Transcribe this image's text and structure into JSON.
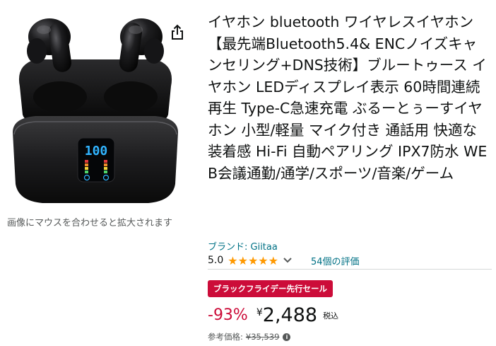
{
  "product": {
    "image_alt": "ワイヤレスイヤホン 充電ケース LEDディスプレイ",
    "case_display": "100",
    "zoom_hint": "画像にマウスを合わせると拡大されます",
    "title": "イヤホン bluetooth ワイヤレスイヤホン 【最先端Bluetooth5.4& ENCノイズキャンセリング+DNS技術】ブルートゥース イヤホン LEDディスプレイ表示 60時間連続再生 Type-C急速充電 ぶるーとぅーすイヤホン 小型/軽量 マイク付き 通話用 快適な装着感 Hi-Fi 自動ペアリング IPX7防水 WEB会議通勤/通学/スポーツ/音楽/ゲーム",
    "brand": "ブランド: Giitaa",
    "rating": "5.0",
    "rating_value": 5,
    "stars": "★★★★★",
    "reviews": "54個の評価",
    "deal_badge": "ブラックフライデー先行セール",
    "discount": "-93%",
    "currency": "¥",
    "price": "2,488",
    "tax_label": "税込",
    "list_price_label": "参考価格:",
    "list_price": "¥35,539",
    "info_icon_glyph": "i"
  },
  "icons": {
    "share": "share-icon",
    "chevron": "chevron-down-icon",
    "info": "info-icon"
  },
  "colors": {
    "link": "#007185",
    "star": "#ff9900",
    "deal": "#cc0c39",
    "text": "#0f1111",
    "muted": "#565959",
    "display_cyan": "#31b4ff"
  }
}
